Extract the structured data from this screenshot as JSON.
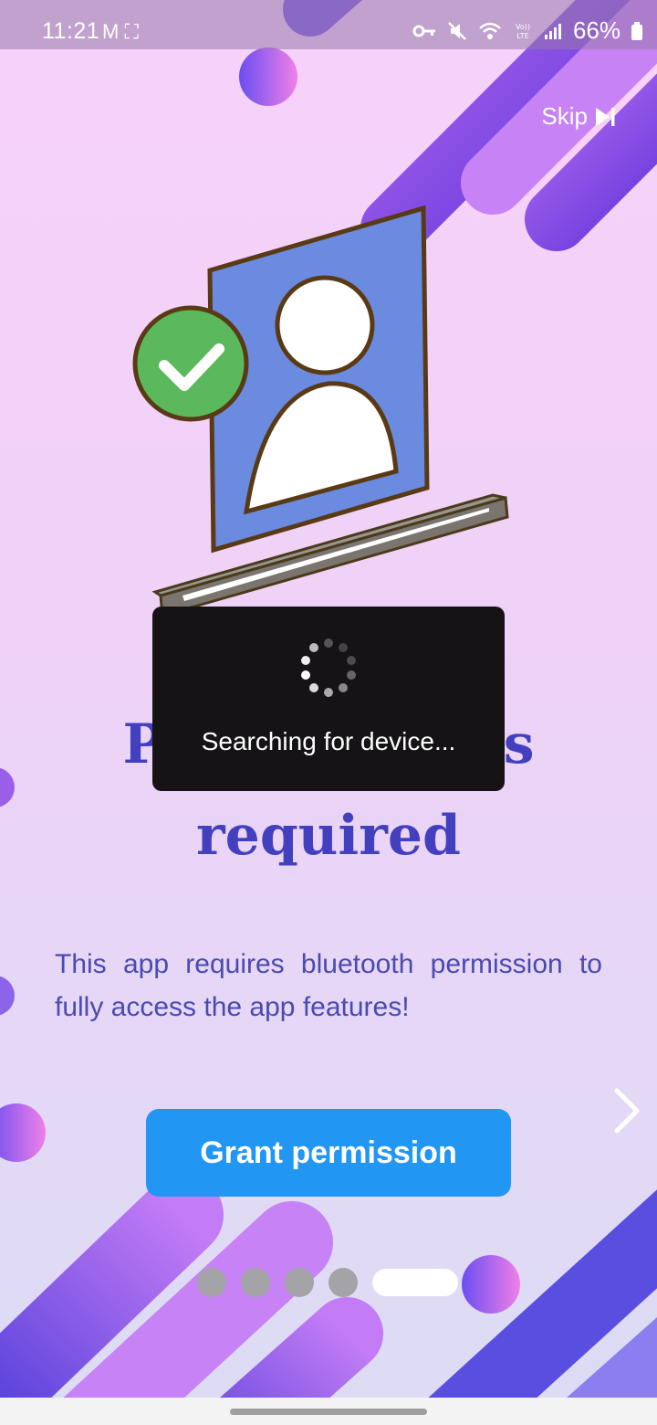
{
  "status_bar": {
    "time": "11:21",
    "left_icons": [
      "gmail-icon",
      "screenshot-icon"
    ],
    "right_icons": [
      "vpn-key-icon",
      "mute-icon",
      "wifi-icon",
      "volte-icon",
      "signal-icon"
    ],
    "battery": "66%"
  },
  "header": {
    "skip_label": "Skip"
  },
  "main": {
    "heading_line1": "Permission is",
    "heading_line2": "required",
    "description": "This app requires bluetooth permission to fully access the app features!",
    "grant_button": "Grant permission"
  },
  "toast": {
    "message": "Searching for device..."
  },
  "pager": {
    "count": 5,
    "active_index": 4
  },
  "colors": {
    "heading": "#4340c0",
    "body_text": "#4a4ab0",
    "button": "#2196f3",
    "toast_bg": "#151315",
    "check_green": "#5cb85c",
    "screen_blue": "#6a8be0"
  }
}
